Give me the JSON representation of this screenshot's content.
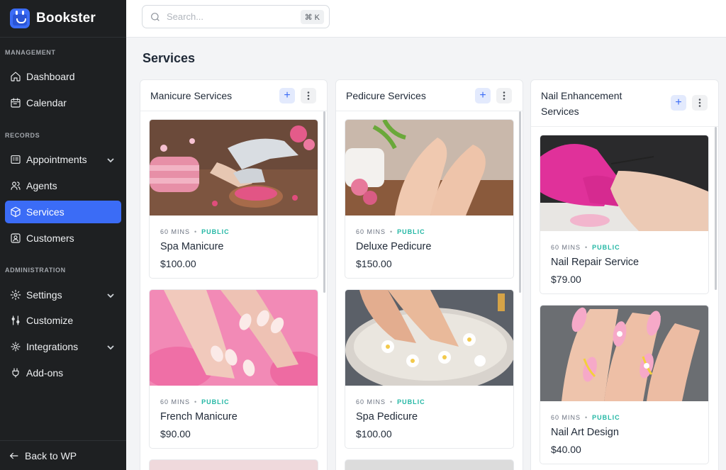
{
  "brand": {
    "name": "Bookster"
  },
  "sidebar": {
    "sections": [
      "MANAGEMENT",
      "RECORDS",
      "ADMINISTRATION"
    ],
    "items": [
      {
        "label": "Dashboard",
        "icon": "home-icon"
      },
      {
        "label": "Calendar",
        "icon": "calendar-icon"
      },
      {
        "label": "Appointments",
        "icon": "appointments-icon",
        "expandable": true
      },
      {
        "label": "Agents",
        "icon": "users-icon"
      },
      {
        "label": "Services",
        "icon": "cube-icon",
        "active": true
      },
      {
        "label": "Customers",
        "icon": "customer-icon"
      },
      {
        "label": "Settings",
        "icon": "gear-icon",
        "expandable": true
      },
      {
        "label": "Customize",
        "icon": "sliders-icon"
      },
      {
        "label": "Integrations",
        "icon": "integrations-icon",
        "expandable": true
      },
      {
        "label": "Add-ons",
        "icon": "plug-icon"
      }
    ],
    "footer": "Back to WP"
  },
  "search": {
    "placeholder": "Search...",
    "shortcut": "⌘ K"
  },
  "page": {
    "title": "Services"
  },
  "colors": {
    "accent": "#3b6cf6",
    "sidebar_bg": "#1e2022",
    "public_badge": "#22b7a4"
  },
  "columns": [
    {
      "title": "Manicure Services",
      "services": [
        {
          "duration": "60 MINS",
          "visibility": "PUBLIC",
          "name": "Spa Manicure",
          "price": "$100.00"
        },
        {
          "duration": "60 MINS",
          "visibility": "PUBLIC",
          "name": "French Manicure",
          "price": "$90.00"
        }
      ]
    },
    {
      "title": "Pedicure Services",
      "services": [
        {
          "duration": "60 MINS",
          "visibility": "PUBLIC",
          "name": "Deluxe Pedicure",
          "price": "$150.00"
        },
        {
          "duration": "60 MINS",
          "visibility": "PUBLIC",
          "name": "Spa Pedicure",
          "price": "$100.00"
        }
      ]
    },
    {
      "title": "Nail Enhancement Services",
      "services": [
        {
          "duration": "60 MINS",
          "visibility": "PUBLIC",
          "name": "Nail Repair Service",
          "price": "$79.00"
        },
        {
          "duration": "60 MINS",
          "visibility": "PUBLIC",
          "name": "Nail Art Design",
          "price": "$40.00"
        }
      ]
    }
  ]
}
